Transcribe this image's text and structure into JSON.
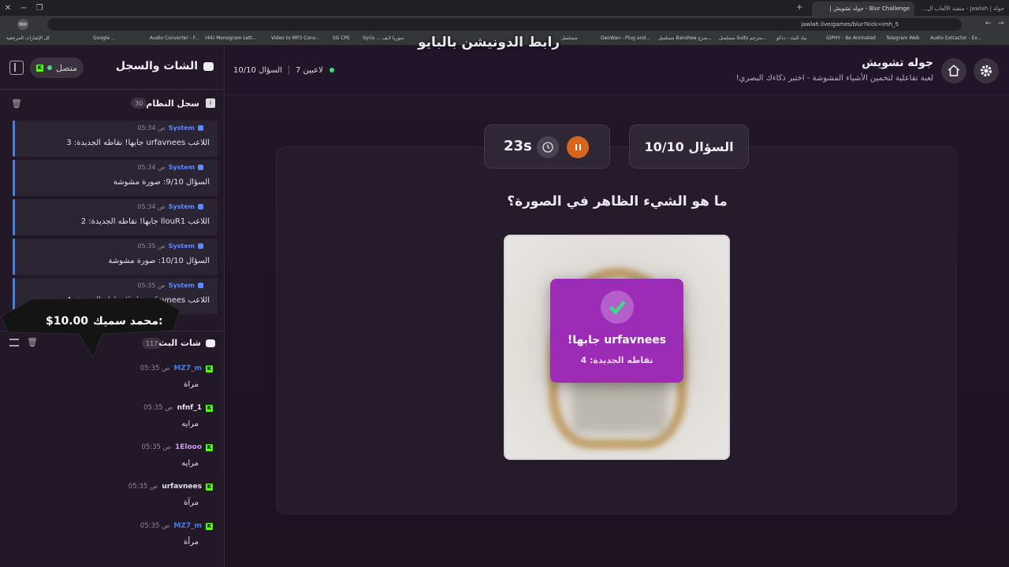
{
  "browser": {
    "tabs": [
      {
        "label": "جولة | Jawlah - منصة الألعاب ال..."
      },
      {
        "label": "Blur Challenge - جوله تشويش |"
      }
    ],
    "url": "jawlah.live/games/blur?kick=imh_5",
    "bookmarks": [
      "كل الإشارات المرجعية",
      "Google ...",
      "Audio Converter - F...",
      "(44) Monogram Lett...",
      "Video to MP3 Conv...",
      "SG CPE",
      "Syria ... سوريا لايف",
      "مسلسل",
      "DeoWan - Plug and...",
      "مسلسل Banshee مترج...",
      "مسلسل Suits مترجم...",
      "بياد البث - دذكو",
      "GIPHY - Be Animated",
      "Telegram Web",
      "Audio Extractor - Ex..."
    ],
    "profile": "MH"
  },
  "stream_overlay": {
    "watermark": "رابط الدونيشن بالبايو",
    "donation_name": "محمد سميك:",
    "donation_amount": "$10.00"
  },
  "sidebar": {
    "title": "الشات والسجل",
    "status_label": "متصل",
    "system_log": {
      "title": "سجل النظام",
      "count": "30",
      "entries": [
        {
          "sender": "System",
          "time": "05:34 ص",
          "message": "اللاعب urfavnees جابها! نقاطه الجديدة: 3"
        },
        {
          "sender": "System",
          "time": "05:34 ص",
          "message": "السؤال 9/10: صورة مشوشة"
        },
        {
          "sender": "System",
          "time": "05:34 ص",
          "message": "اللاعب llouR1 جابها! نقاطه الجديدة: 2"
        },
        {
          "sender": "System",
          "time": "05:35 ص",
          "message": "السؤال 10/10: صورة مشوشة"
        },
        {
          "sender": "System",
          "time": "05:35 ص",
          "message": "اللاعب urfavnees جابها! نقاطه الجديدة: 4"
        }
      ]
    },
    "live_chat": {
      "title": "شات البث",
      "count": "117",
      "messages": [
        {
          "user": "MZ7_m",
          "time": "05:35 ص",
          "text": "مراة",
          "color": "#4a7fe0"
        },
        {
          "user": "nfnf_1",
          "time": "05:35 ص",
          "text": "مرايه",
          "color": "#e6e1ec"
        },
        {
          "user": "1Elooo",
          "time": "05:35 ص",
          "text": "مرايه",
          "color": "#c79be8"
        },
        {
          "user": "urfavnees",
          "time": "05:35 ص",
          "text": "مرآة",
          "color": "#e6e1ec"
        },
        {
          "user": "MZ7_m",
          "time": "05:35 ص",
          "text": "مرأة",
          "color": "#4a7fe0"
        }
      ]
    }
  },
  "header": {
    "title": "جوله تشويش",
    "subtitle": "لعبة تفاعلية لتخمين الأشياء المشوشة - اختبر ذكاءك البصري!",
    "players": "7 لاعبين",
    "question_progress": "السؤال 10/10"
  },
  "game": {
    "question_label": "السؤال 10/10",
    "timer": "23s",
    "question": "ما هو الشيء الظاهر في الصورة؟",
    "popup_title": "urfavnees جابها!",
    "popup_sub": "نقاطه الجديدة: 4"
  },
  "colors": {
    "accent": "#9c2bb6",
    "kick_green": "#53fc18",
    "pause_orange": "#d9651a"
  }
}
